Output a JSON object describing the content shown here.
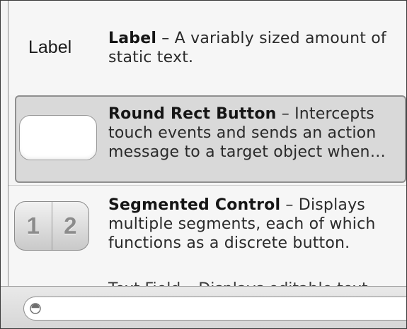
{
  "library": {
    "items": [
      {
        "id": "label",
        "preview_text": "Label",
        "title": "Label",
        "description": " – A variably sized amount of static text."
      },
      {
        "id": "round-rect-button",
        "title": "Round Rect Button",
        "description": " – Intercepts touch events and sends an action message to a target object when…",
        "selected": true
      },
      {
        "id": "segmented-control",
        "segments": [
          "1",
          "2"
        ],
        "title": "Segmented Control",
        "description": " – Displays multiple segments, each of which functions as a discrete button."
      }
    ],
    "partial_item_text": "Text Field – Displays editable text"
  },
  "filter": {
    "value": "",
    "placeholder": "",
    "icon": "filter-icon"
  },
  "colors": {
    "selected_background": "#d9d9d9",
    "selected_border": "#8f8f8f",
    "segment_digit": "#8b8b8b"
  }
}
